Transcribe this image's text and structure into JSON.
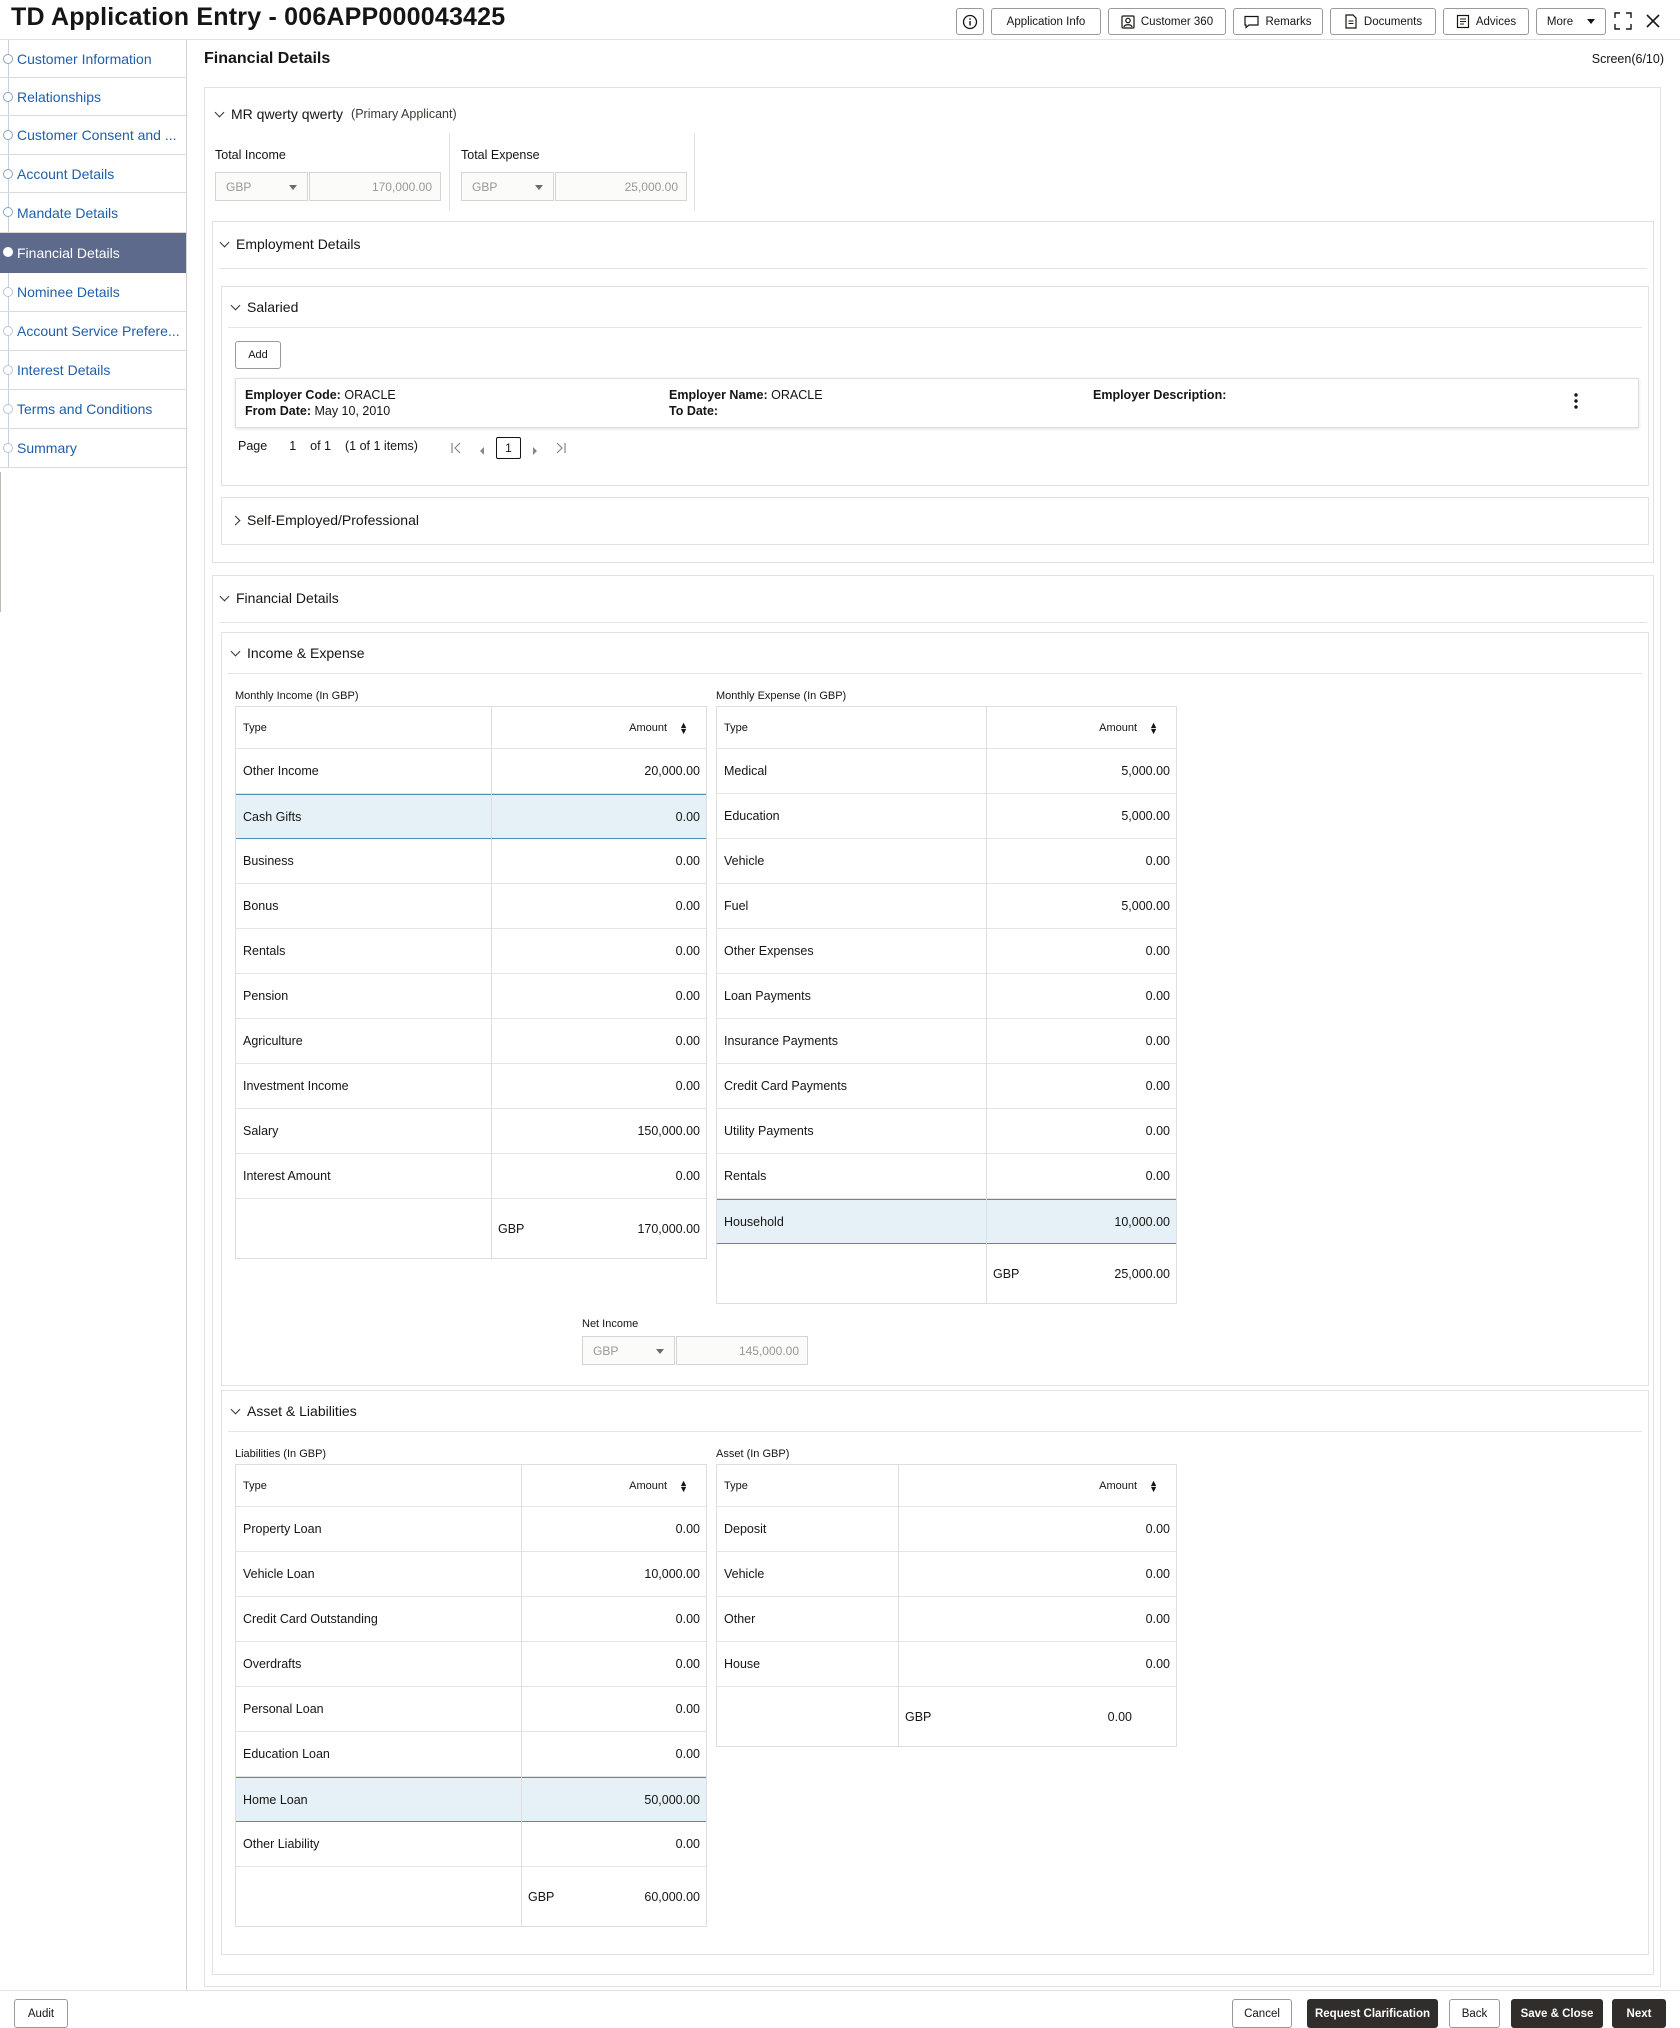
{
  "header": {
    "title": "TD Application Entry - 006APP000043425",
    "buttons": {
      "application_info": "Application Info",
      "customer_360": "Customer 360",
      "remarks": "Remarks",
      "documents": "Documents",
      "advices": "Advices",
      "more": "More"
    }
  },
  "sidebar": {
    "items": [
      {
        "label": "Customer Information",
        "state": "done"
      },
      {
        "label": "Relationships",
        "state": "done"
      },
      {
        "label": "Customer Consent and ...",
        "state": "done"
      },
      {
        "label": "Account Details",
        "state": "done"
      },
      {
        "label": "Mandate Details",
        "state": "done"
      },
      {
        "label": "Financial Details",
        "state": "active"
      },
      {
        "label": "Nominee Details",
        "state": "pending"
      },
      {
        "label": "Account Service Prefere...",
        "state": "pending"
      },
      {
        "label": "Interest Details",
        "state": "pending"
      },
      {
        "label": "Terms and Conditions",
        "state": "pending"
      },
      {
        "label": "Summary",
        "state": "pending"
      }
    ]
  },
  "main": {
    "page_title": "Financial Details",
    "screen_counter": "Screen(6/10)",
    "applicant": {
      "name": "MR qwerty qwerty",
      "role": "(Primary Applicant)",
      "total_income_label": "Total Income",
      "total_income_currency": "GBP",
      "total_income_value": "170,000.00",
      "total_expense_label": "Total Expense",
      "total_expense_currency": "GBP",
      "total_expense_value": "25,000.00"
    },
    "employment": {
      "title": "Employment Details",
      "salaried_title": "Salaried",
      "add_label": "Add",
      "card": {
        "employer_code_label": "Employer Code:",
        "employer_code": "ORACLE",
        "from_date_label": "From Date:",
        "from_date": "May 10, 2010",
        "employer_name_label": "Employer Name:",
        "employer_name": "ORACLE",
        "to_date_label": "To Date:",
        "employer_description_label": "Employer Description:"
      },
      "pagination": {
        "page_label": "Page",
        "page": "1",
        "of_label": "of 1",
        "items_label": "(1 of 1 items)",
        "current": "1"
      },
      "self_employed_title": "Self-Employed/Professional"
    },
    "financial": {
      "title": "Financial Details",
      "income_expense_title": "Income & Expense",
      "income_caption": "Monthly Income (In GBP)",
      "expense_caption": "Monthly Expense (In GBP)",
      "type_header": "Type",
      "amount_header": "Amount",
      "income_rows": [
        {
          "type": "Other Income",
          "amount": "20,000.00"
        },
        {
          "type": "Cash Gifts",
          "amount": "0.00"
        },
        {
          "type": "Business",
          "amount": "0.00"
        },
        {
          "type": "Bonus",
          "amount": "0.00"
        },
        {
          "type": "Rentals",
          "amount": "0.00"
        },
        {
          "type": "Pension",
          "amount": "0.00"
        },
        {
          "type": "Agriculture",
          "amount": "0.00"
        },
        {
          "type": "Investment Income",
          "amount": "0.00"
        },
        {
          "type": "Salary",
          "amount": "150,000.00"
        },
        {
          "type": "Interest Amount",
          "amount": "0.00"
        }
      ],
      "income_total_currency": "GBP",
      "income_total": "170,000.00",
      "expense_rows": [
        {
          "type": "Medical",
          "amount": "5,000.00"
        },
        {
          "type": "Education",
          "amount": "5,000.00"
        },
        {
          "type": "Vehicle",
          "amount": "0.00"
        },
        {
          "type": "Fuel",
          "amount": "5,000.00"
        },
        {
          "type": "Other Expenses",
          "amount": "0.00"
        },
        {
          "type": "Loan Payments",
          "amount": "0.00"
        },
        {
          "type": "Insurance Payments",
          "amount": "0.00"
        },
        {
          "type": "Credit Card Payments",
          "amount": "0.00"
        },
        {
          "type": "Utility Payments",
          "amount": "0.00"
        },
        {
          "type": "Rentals",
          "amount": "0.00"
        },
        {
          "type": "Household",
          "amount": "10,000.00"
        }
      ],
      "expense_total_currency": "GBP",
      "expense_total": "25,000.00",
      "net_income_label": "Net Income",
      "net_income_currency": "GBP",
      "net_income_value": "145,000.00",
      "asset_liab_title": "Asset & Liabilities",
      "liab_caption": "Liabilities (In GBP)",
      "asset_caption": "Asset (In GBP)",
      "liab_rows": [
        {
          "type": "Property Loan",
          "amount": "0.00"
        },
        {
          "type": "Vehicle Loan",
          "amount": "10,000.00"
        },
        {
          "type": "Credit Card Outstanding",
          "amount": "0.00"
        },
        {
          "type": "Overdrafts",
          "amount": "0.00"
        },
        {
          "type": "Personal Loan",
          "amount": "0.00"
        },
        {
          "type": "Education Loan",
          "amount": "0.00"
        },
        {
          "type": "Home Loan",
          "amount": "50,000.00"
        },
        {
          "type": "Other Liability",
          "amount": "0.00"
        }
      ],
      "liab_total_currency": "GBP",
      "liab_total": "60,000.00",
      "asset_rows": [
        {
          "type": "Deposit",
          "amount": "0.00"
        },
        {
          "type": "Vehicle",
          "amount": "0.00"
        },
        {
          "type": "Other",
          "amount": "0.00"
        },
        {
          "type": "House",
          "amount": "0.00"
        }
      ],
      "asset_total_currency": "GBP",
      "asset_total": "0.00"
    }
  },
  "footer": {
    "audit": "Audit",
    "cancel": "Cancel",
    "request_clarification": "Request Clarification",
    "back": "Back",
    "save_close": "Save & Close",
    "next": "Next"
  }
}
